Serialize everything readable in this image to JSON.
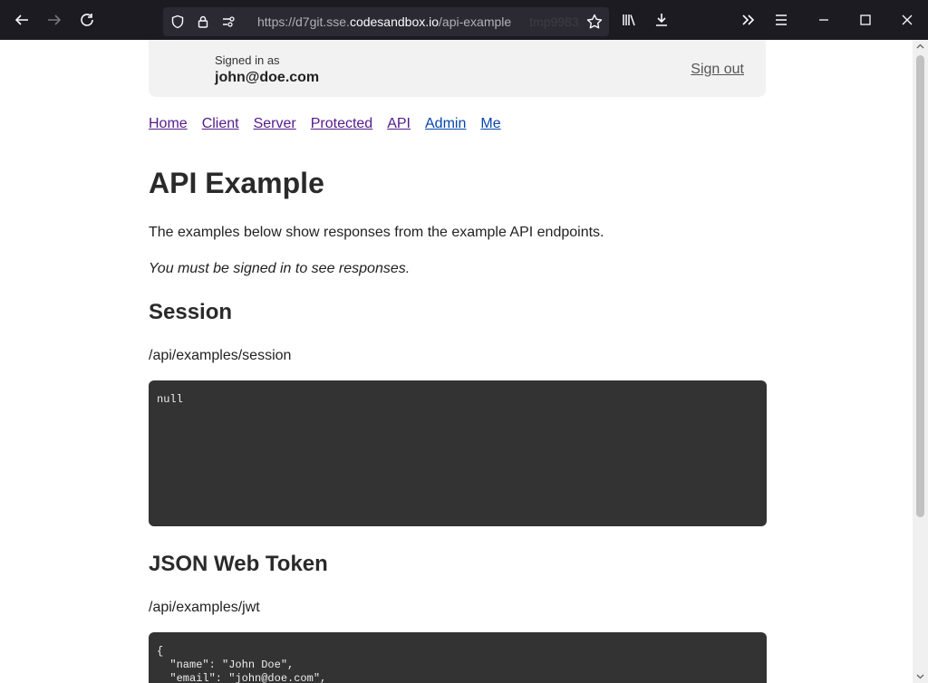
{
  "browser": {
    "url_prefix": "https://d7git.sse.",
    "url_host": "codesandbox.io",
    "url_path": "/api-example",
    "url_ghost": "tmp9983"
  },
  "header": {
    "signed_in_label": "Signed in as",
    "email": "john@doe.com",
    "sign_out": "Sign out"
  },
  "nav": {
    "items": [
      "Home",
      "Client",
      "Server",
      "Protected",
      "API",
      "Admin",
      "Me"
    ]
  },
  "main": {
    "title": "API Example",
    "intro": "The examples below show responses from the example API endpoints.",
    "notice": "You must be signed in to see responses.",
    "sections": [
      {
        "heading": "Session",
        "endpoint": "/api/examples/session",
        "response": "null"
      },
      {
        "heading": "JSON Web Token",
        "endpoint": "/api/examples/jwt",
        "response": "{\n  \"name\": \"John Doe\",\n  \"email\": \"john@doe.com\","
      }
    ]
  }
}
